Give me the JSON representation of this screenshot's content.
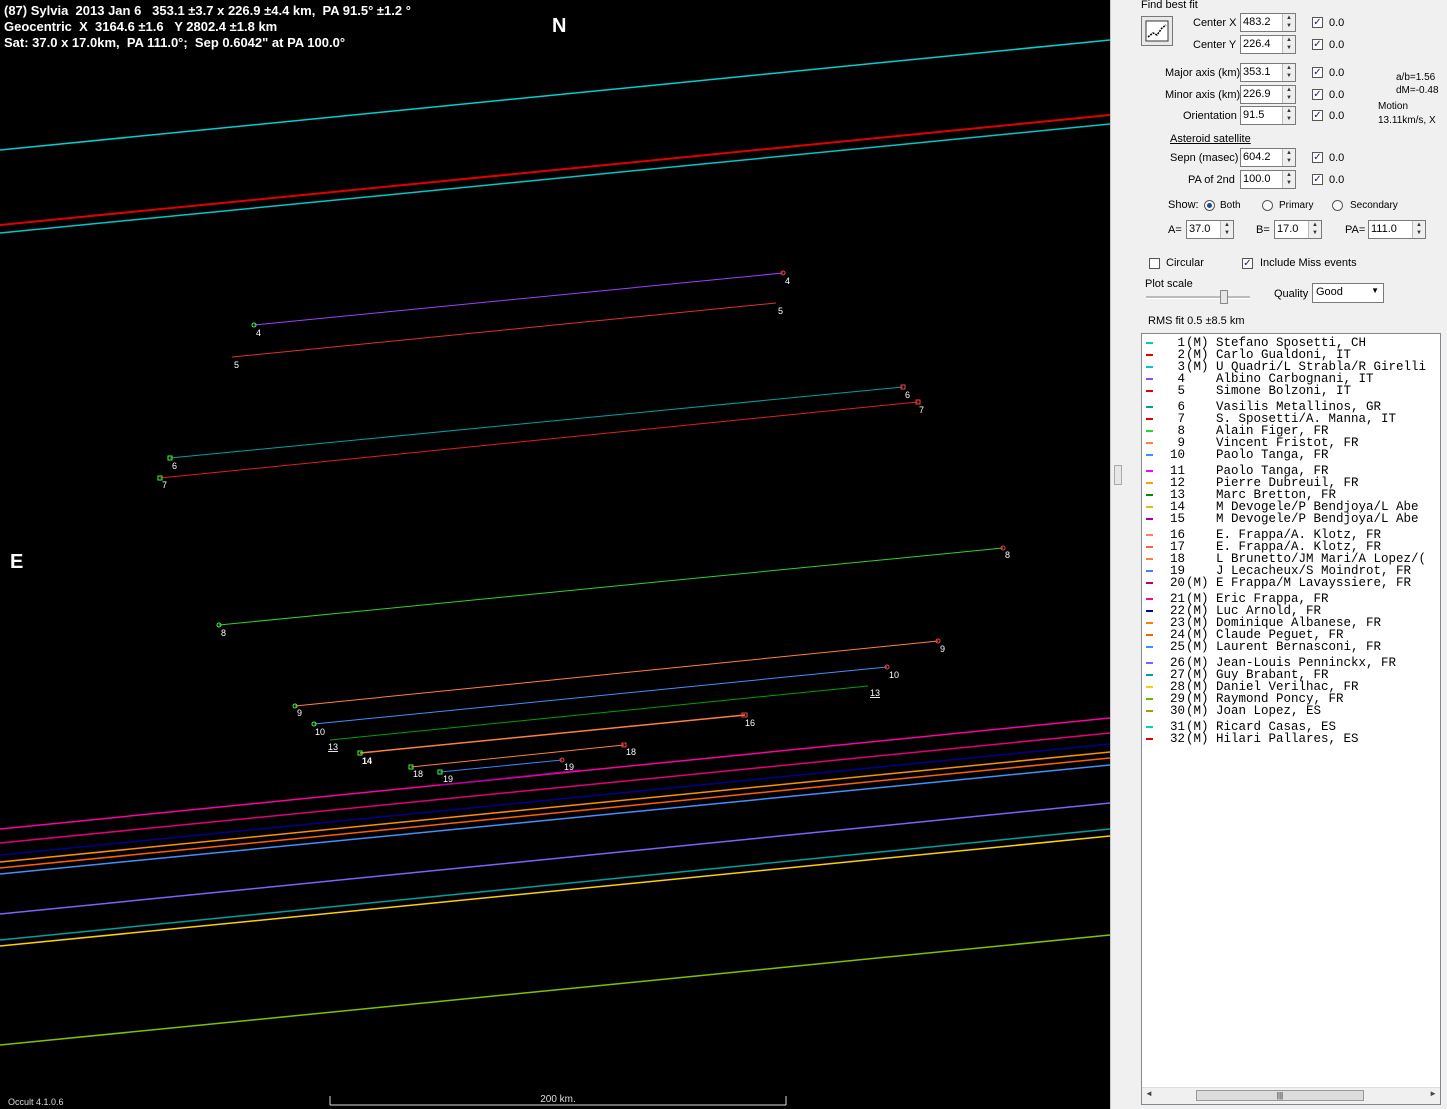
{
  "plot": {
    "header_line1": "(87) Sylvia  2013 Jan 6   353.1 ±3.7 x 226.9 ±4.4 km,  PA 91.5° ±1.2 °",
    "header_line2": "Geocentric  X  3164.6 ±1.6   Y 2802.4 ±1.8 km",
    "header_line3": "Sat: 37.0 x 17.0km,  PA 111.0°;  Sep 0.6042\" at PA 100.0°",
    "north_label": "N",
    "east_label": "E",
    "scale_label": "200 km.",
    "version": "Occult 4.1.0.6",
    "colors": {
      "background": "#000000",
      "text": "#ffffff"
    }
  },
  "panel": {
    "find_best_fit_label": "Find best fit",
    "center_x_label": "Center X",
    "center_x_value": "483.2",
    "center_x_delta": "0.0",
    "center_y_label": "Center Y",
    "center_y_value": "226.4",
    "center_y_delta": "0.0",
    "major_axis_label": "Major axis (km)",
    "major_axis_value": "353.1",
    "major_axis_delta": "0.0",
    "minor_axis_label": "Minor axis (km)",
    "minor_axis_value": "226.9",
    "minor_axis_delta": "0.0",
    "orientation_label": "Orientation",
    "orientation_value": "91.5",
    "orientation_delta": "0.0",
    "ab_ratio": "a/b=1.56",
    "dm": "dM=-0.48",
    "motion_label": "Motion",
    "motion_value": "13.11km/s, X",
    "satellite_label": "Asteroid satellite",
    "sepn_label": "Sepn (masec)",
    "sepn_value": "604.2",
    "sepn_delta": "0.0",
    "pa2_label": "PA of 2nd",
    "pa2_value": "100.0",
    "pa2_delta": "0.0",
    "show_label": "Show:",
    "show_both": "Both",
    "show_primary": "Primary",
    "show_secondary": "Secondary",
    "a_label": "A=",
    "a_value": "37.0",
    "b_label": "B=",
    "b_value": "17.0",
    "pa_label": "PA=",
    "pa_value": "111.0",
    "circular_label": "Circular",
    "include_miss_label": "Include Miss events",
    "plot_scale_label": "Plot scale",
    "slider_level": 0.75,
    "quality_label": "Quality",
    "quality_value": "Good",
    "rms_label": "RMS fit 0.5 ±8.5 km"
  },
  "observers": [
    {
      "n": "1",
      "m": "(M)",
      "name": "Stefano Sposetti, CH",
      "color": "#00c8c8"
    },
    {
      "n": "2",
      "m": "(M)",
      "name": "Carlo Gualdoni, IT",
      "color": "#e00000"
    },
    {
      "n": "3",
      "m": "(M)",
      "name": "U Quadri/L Strabla/R Girelli",
      "color": "#00c8c8"
    },
    {
      "n": "4",
      "m": "",
      "name": "Albino Carbognani, IT",
      "color": "#a040ff"
    },
    {
      "n": "5",
      "m": "",
      "name": "Simone Bolzoni, IT",
      "color": "#e00000"
    },
    {
      "n": "6",
      "m": "",
      "name": "Vasilis Metallinos, GR",
      "color": "#00a0a0"
    },
    {
      "n": "7",
      "m": "",
      "name": "S. Sposetti/A. Manna, IT",
      "color": "#e00000"
    },
    {
      "n": "8",
      "m": "",
      "name": "Alain Figer, FR",
      "color": "#30d030"
    },
    {
      "n": "9",
      "m": "",
      "name": "Vincent Fristot, FR",
      "color": "#ff8040"
    },
    {
      "n": "10",
      "m": "",
      "name": "Paolo Tanga, FR",
      "color": "#4090ff"
    },
    {
      "n": "11",
      "m": "",
      "name": "Paolo Tanga, FR",
      "color": "#ff00ff"
    },
    {
      "n": "12",
      "m": "",
      "name": "Pierre Dubreuil, FR",
      "color": "#ffa000"
    },
    {
      "n": "13",
      "m": "",
      "name": "Marc Bretton, FR",
      "color": "#008800"
    },
    {
      "n": "14",
      "m": "",
      "name": "M Devogele/P Bendjoya/L Abe",
      "color": "#e0c000"
    },
    {
      "n": "15",
      "m": "",
      "name": "M Devogele/P Bendjoya/L Abe",
      "color": "#a000a0"
    },
    {
      "n": "16",
      "m": "",
      "name": "E. Frappa/A. Klotz, FR",
      "color": "#ff8060"
    },
    {
      "n": "17",
      "m": "",
      "name": "E. Frappa/A. Klotz, FR",
      "color": "#ff6040"
    },
    {
      "n": "18",
      "m": "",
      "name": "L Brunetto/JM Mari/A Lopez/(",
      "color": "#ff8040"
    },
    {
      "n": "19",
      "m": "",
      "name": "J Lecacheux/S Moindrot, FR",
      "color": "#4080ff"
    },
    {
      "n": "20",
      "m": "(M)",
      "name": "E Frappa/M Lavayssiere, FR",
      "color": "#c00060"
    },
    {
      "n": "21",
      "m": "(M)",
      "name": "Eric Frappa, FR",
      "color": "#ff00a0"
    },
    {
      "n": "22",
      "m": "(M)",
      "name": "Luc Arnold, FR",
      "color": "#0000a0"
    },
    {
      "n": "23",
      "m": "(M)",
      "name": "Dominique Albanese, FR",
      "color": "#ff8000"
    },
    {
      "n": "24",
      "m": "(M)",
      "name": "Claude Peguet, FR",
      "color": "#ff6000"
    },
    {
      "n": "25",
      "m": "(M)",
      "name": "Laurent Bernasconi, FR",
      "color": "#4090ff"
    },
    {
      "n": "26",
      "m": "(M)",
      "name": "Jean-Louis Penninckx, FR",
      "color": "#8060ff"
    },
    {
      "n": "27",
      "m": "(M)",
      "name": "Guy Brabant, FR",
      "color": "#00a0a0"
    },
    {
      "n": "28",
      "m": "(M)",
      "name": "Daniel Verilhac, FR",
      "color": "#ffd000"
    },
    {
      "n": "29",
      "m": "(M)",
      "name": "Raymond Poncy, FR",
      "color": "#60c000"
    },
    {
      "n": "30",
      "m": "(M)",
      "name": "Joan Lopez, ES",
      "color": "#a0a000"
    },
    {
      "n": "31",
      "m": "(M)",
      "name": "Ricard Casas, ES",
      "color": "#00d0d0"
    },
    {
      "n": "32",
      "m": "(M)",
      "name": "Hilari Pallares, ES",
      "color": "#e00000"
    }
  ],
  "chords": [
    {
      "label": "4",
      "color": "#a040ff"
    },
    {
      "label": "5",
      "color": "#e03030"
    },
    {
      "label": "6",
      "color": "#00a0a0"
    },
    {
      "label": "7",
      "color": "#e02020"
    },
    {
      "label": "8",
      "color": "#30d030"
    },
    {
      "label": "9",
      "color": "#ff8040"
    },
    {
      "label": "10",
      "color": "#4090ff"
    },
    {
      "label": "13",
      "color": "#00a000"
    },
    {
      "label": "14",
      "color": "#ff8040"
    },
    {
      "label": "16",
      "color": "#ff6040"
    },
    {
      "label": "18",
      "color": "#ff8040"
    },
    {
      "label": "19",
      "color": "#4080ff"
    }
  ]
}
